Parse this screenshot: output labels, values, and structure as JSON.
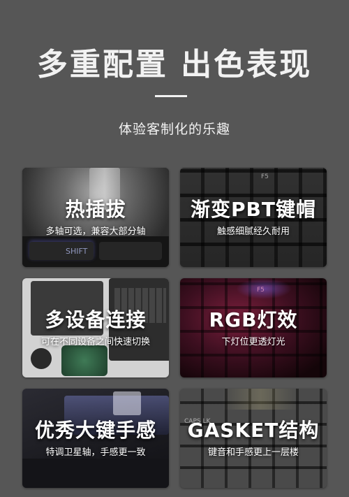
{
  "header": {
    "title": "多重配置 出色表现",
    "subtitle": "体验客制化的乐趣"
  },
  "cards": [
    {
      "title": "热插拔",
      "subtitle": "多轴可选，兼容大部分轴",
      "key_label": "SHIFT"
    },
    {
      "title": "渐变PBT键帽",
      "subtitle": "触感细腻经久耐用",
      "key_label": "F5"
    },
    {
      "title": "多设备连接",
      "subtitle": "可在不同设备之间快速切换"
    },
    {
      "title": "RGB灯效",
      "subtitle": "下灯位更透灯光",
      "key_label": "F5"
    },
    {
      "title": "优秀大键手感",
      "subtitle": "特调卫星轴，手感更一致"
    },
    {
      "title": "GASKET结构",
      "subtitle": "键音和手感更上一层楼",
      "key_label": "CAPS LK"
    }
  ],
  "colors": {
    "background": "#565656",
    "text": "#f2f2f2",
    "rgb_glow": "#b0305a"
  }
}
